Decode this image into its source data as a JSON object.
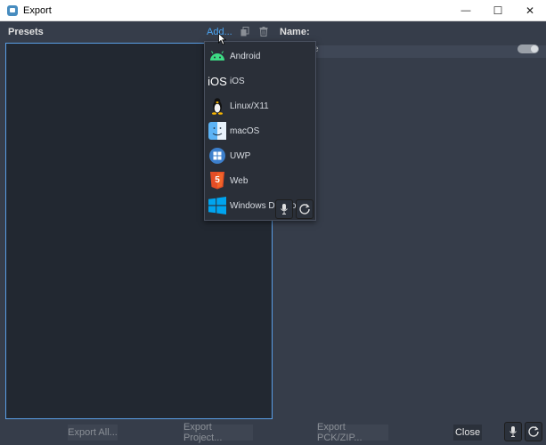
{
  "window": {
    "title": "Export",
    "minimize_glyph": "—",
    "maximize_glyph": "☐",
    "close_glyph": "✕"
  },
  "toolbar": {
    "presets_label": "Presets",
    "add_label": "Add...",
    "name_label": "Name:"
  },
  "add_menu": {
    "items": [
      {
        "label": "Android",
        "icon": "android-icon"
      },
      {
        "label": "iOS",
        "icon": "ios-icon",
        "icon_text": "iOS"
      },
      {
        "label": "Linux/X11",
        "icon": "linux-icon"
      },
      {
        "label": "macOS",
        "icon": "macos-icon"
      },
      {
        "label": "UWP",
        "icon": "uwp-icon"
      },
      {
        "label": "Web",
        "icon": "html5-icon",
        "icon_text": "5"
      },
      {
        "label": "Windows Desktop",
        "icon": "windows-icon"
      }
    ]
  },
  "right_panel": {
    "partial_label": "e"
  },
  "bottom_bar": {
    "export_all_label": "Export All...",
    "export_project_label": "Export Project...",
    "export_pck_label": "Export PCK/ZIP...",
    "close_label": "Close"
  },
  "colors": {
    "accent": "#4aa3f0",
    "panel": "#363d4a",
    "list_bg": "#222831",
    "android_green": "#3ddc84",
    "html5_orange": "#e44d26",
    "windows_blue": "#00a4ef"
  }
}
